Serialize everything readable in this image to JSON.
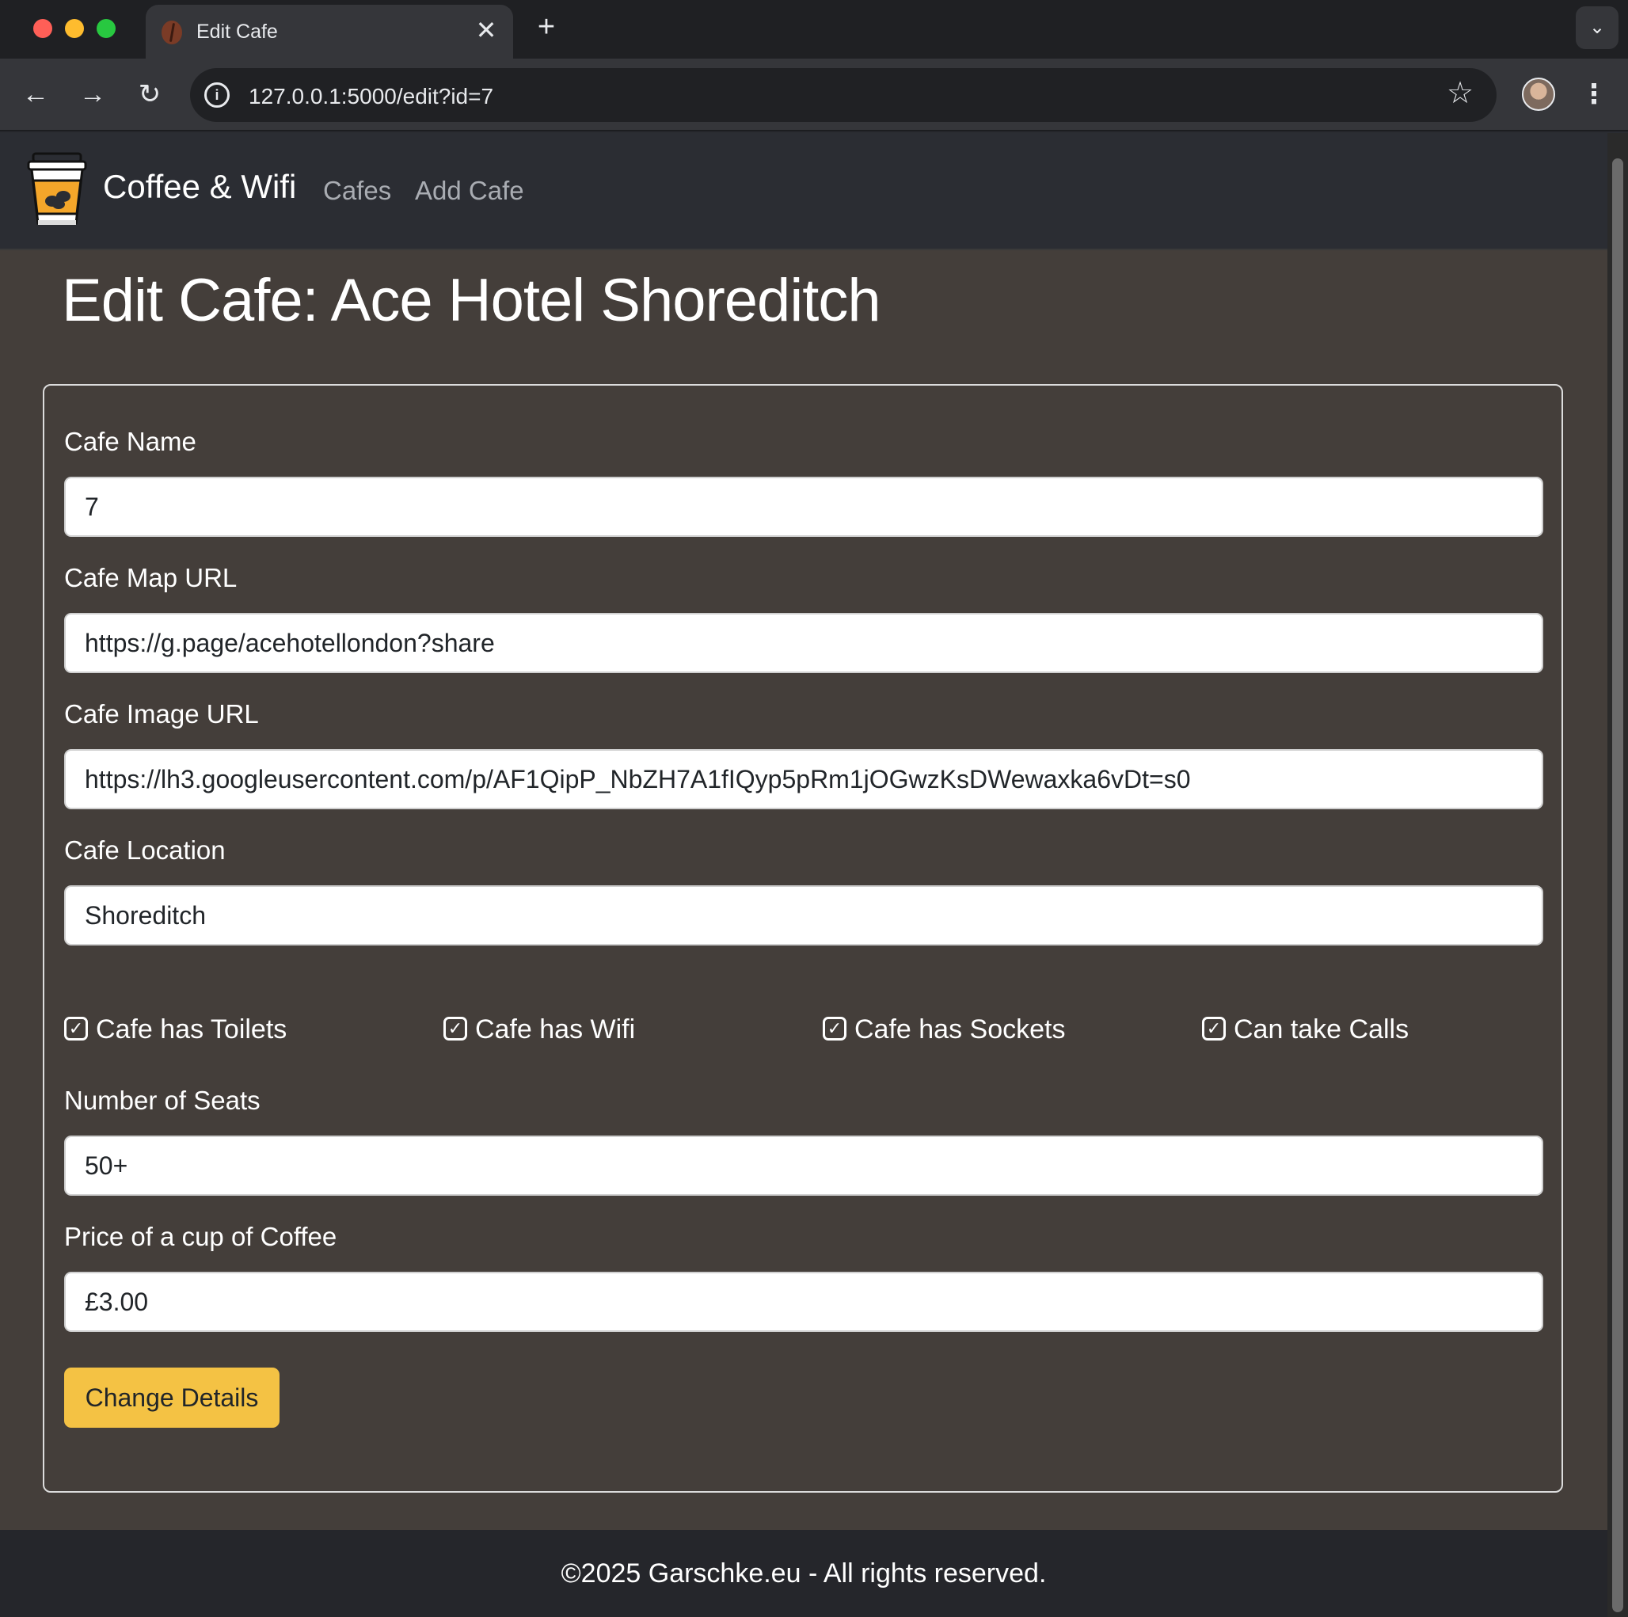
{
  "browser": {
    "tab_title": "Edit Cafe",
    "tab_close_glyph": "✕",
    "new_tab_glyph": "+",
    "tab_menu_glyph": "⌄",
    "url": "127.0.0.1:5000/edit?id=7",
    "back_glyph": "←",
    "forward_glyph": "→",
    "reload_glyph": "↻",
    "site_info_glyph": "i",
    "bookmark_glyph": "☆",
    "menu_glyph": "⋮",
    "icons": {
      "favicon": "coffee-bean-icon",
      "profile": "avatar"
    }
  },
  "navbar": {
    "brand": "Coffee & Wifi",
    "links": [
      "Cafes",
      "Add Cafe"
    ],
    "logo_icon": "coffee-cup-icon"
  },
  "page": {
    "title": "Edit Cafe: Ace Hotel Shoreditch"
  },
  "form": {
    "fields": [
      {
        "label": "Cafe Name",
        "value": "7"
      },
      {
        "label": "Cafe Map URL",
        "value": "https://g.page/acehotellondon?share"
      },
      {
        "label": "Cafe Image URL",
        "value": "https://lh3.googleusercontent.com/p/AF1QipP_NbZH7A1fIQyp5pRm1jOGwzKsDWewaxka6vDt=s0"
      },
      {
        "label": "Cafe Location",
        "value": "Shoreditch"
      }
    ],
    "checkboxes": [
      {
        "label": "Cafe has Toilets",
        "checked": true
      },
      {
        "label": "Cafe has Wifi",
        "checked": true
      },
      {
        "label": "Cafe has Sockets",
        "checked": true
      },
      {
        "label": "Can take Calls",
        "checked": true
      }
    ],
    "check_glyph": "✓",
    "seats": {
      "label": "Number of Seats",
      "value": "50+"
    },
    "price": {
      "label": "Price of a cup of Coffee",
      "value": "£3.00"
    },
    "submit_label": "Change Details"
  },
  "footer": {
    "text": "©2025 Garschke.eu - All rights reserved."
  },
  "colors": {
    "page_bg": "#443e3a",
    "navbar_bg": "#2b2d33",
    "footer_bg": "#25262b",
    "button_accent": "#f4c244"
  }
}
